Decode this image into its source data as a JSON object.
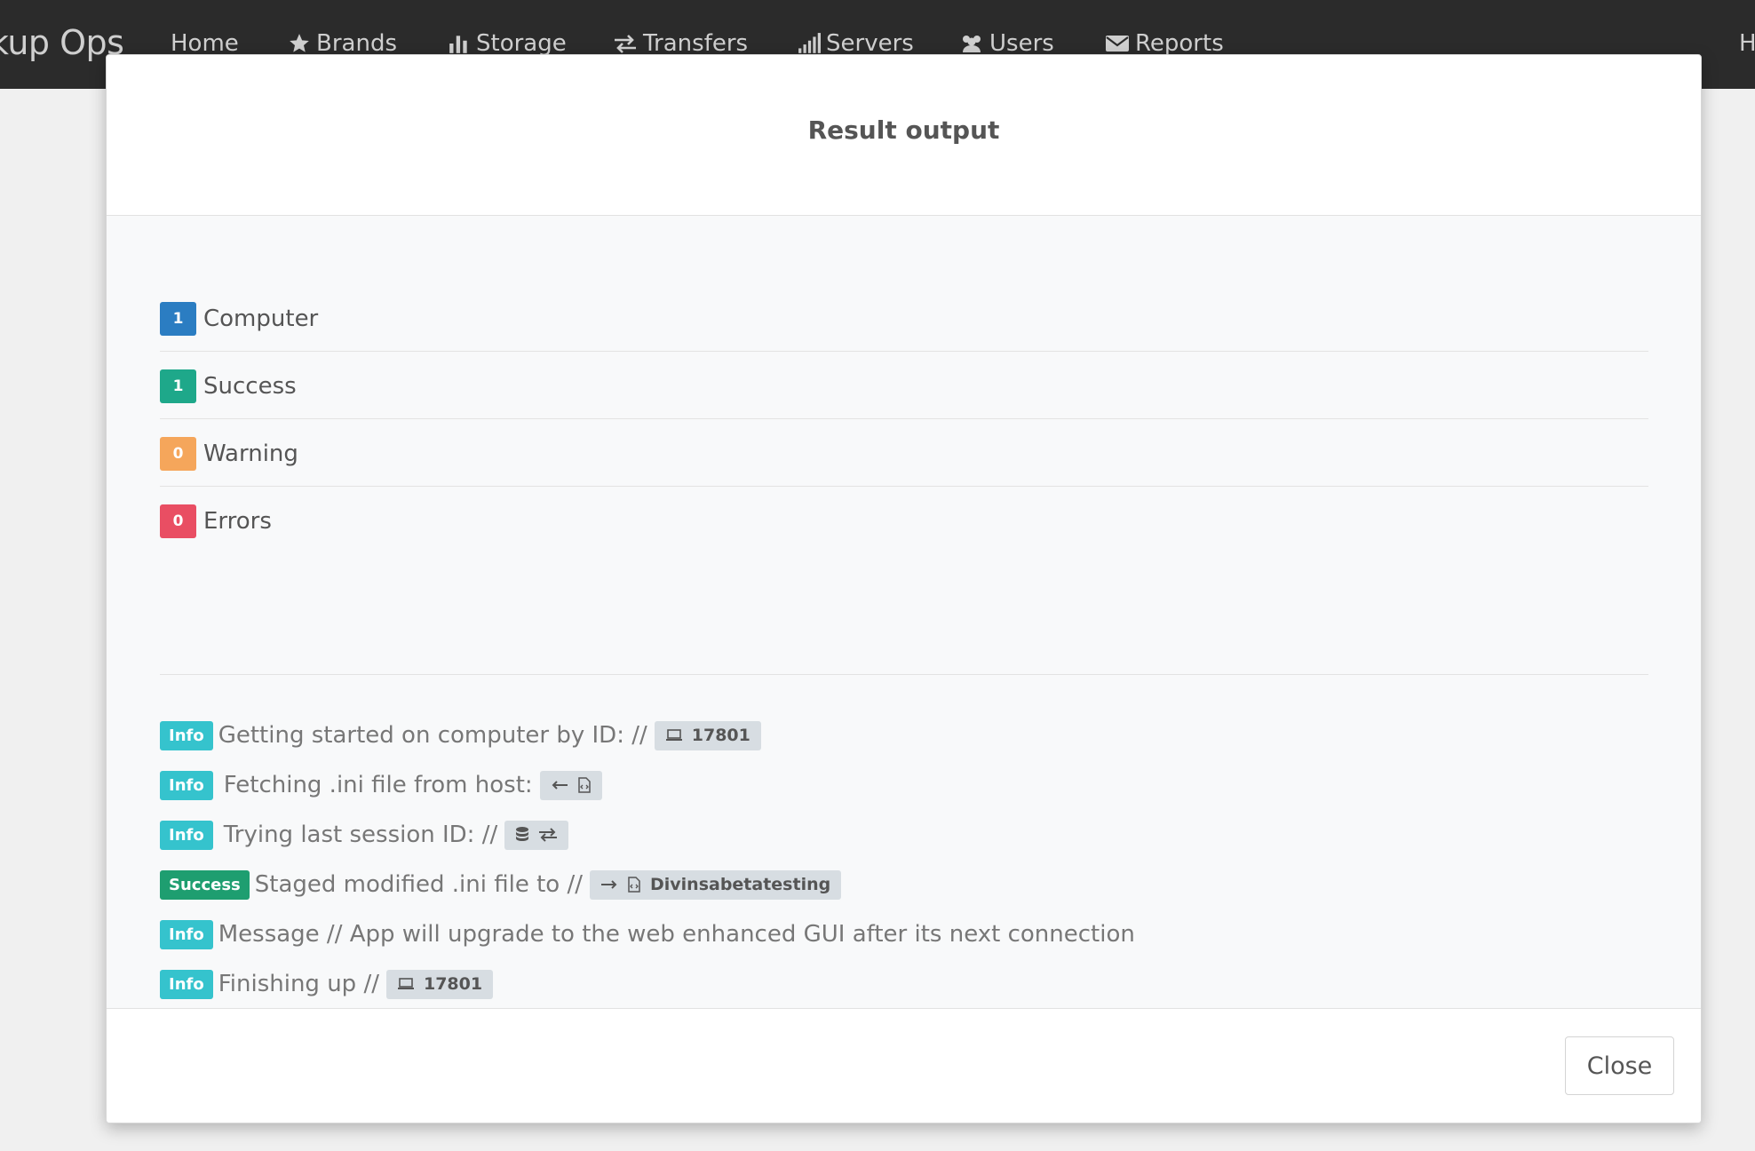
{
  "navbar": {
    "brand": "kup Ops",
    "items": [
      {
        "label": "Home",
        "icon": ""
      },
      {
        "label": "Brands",
        "icon": "star-icon"
      },
      {
        "label": "Storage",
        "icon": "bar-chart-icon"
      },
      {
        "label": "Transfers",
        "icon": "transfer-icon"
      },
      {
        "label": "Servers",
        "icon": "signal-icon"
      },
      {
        "label": "Users",
        "icon": "users-icon"
      },
      {
        "label": "Reports",
        "icon": "envelope-icon"
      }
    ],
    "right_label": "H"
  },
  "modal": {
    "title": "Result output",
    "close_label": "Close"
  },
  "summary": [
    {
      "count": "1",
      "label": "Computer",
      "color": "#2b7dc2"
    },
    {
      "count": "1",
      "label": "Success",
      "color": "#1ea88a"
    },
    {
      "count": "0",
      "label": "Warning",
      "color": "#f5a65b"
    },
    {
      "count": "0",
      "label": "Errors",
      "color": "#e94e63"
    }
  ],
  "log": [
    {
      "tag": "Info",
      "text": "Getting started on computer by ID: //",
      "chip_icons": [
        "laptop-icon"
      ],
      "chip_text": "17801"
    },
    {
      "tag": "Info",
      "text": "Fetching .ini file from host:",
      "chip_icons": [
        "arrow-left-icon",
        "code-file-icon"
      ],
      "chip_text": ""
    },
    {
      "tag": "Info",
      "text": "Trying last session ID: //",
      "chip_icons": [
        "database-icon",
        "exchange-icon"
      ],
      "chip_text": ""
    },
    {
      "tag": "Success",
      "text": "Staged modified .ini file to //",
      "chip_icons": [
        "arrow-right-icon",
        "code-file-icon"
      ],
      "chip_text": "Divinsabetatesting"
    },
    {
      "tag": "Info",
      "text": "Message // App will upgrade to the web enhanced GUI after its next connection"
    },
    {
      "tag": "Info",
      "text": "Finishing up //",
      "chip_icons": [
        "laptop-icon"
      ],
      "chip_text": "17801"
    }
  ]
}
